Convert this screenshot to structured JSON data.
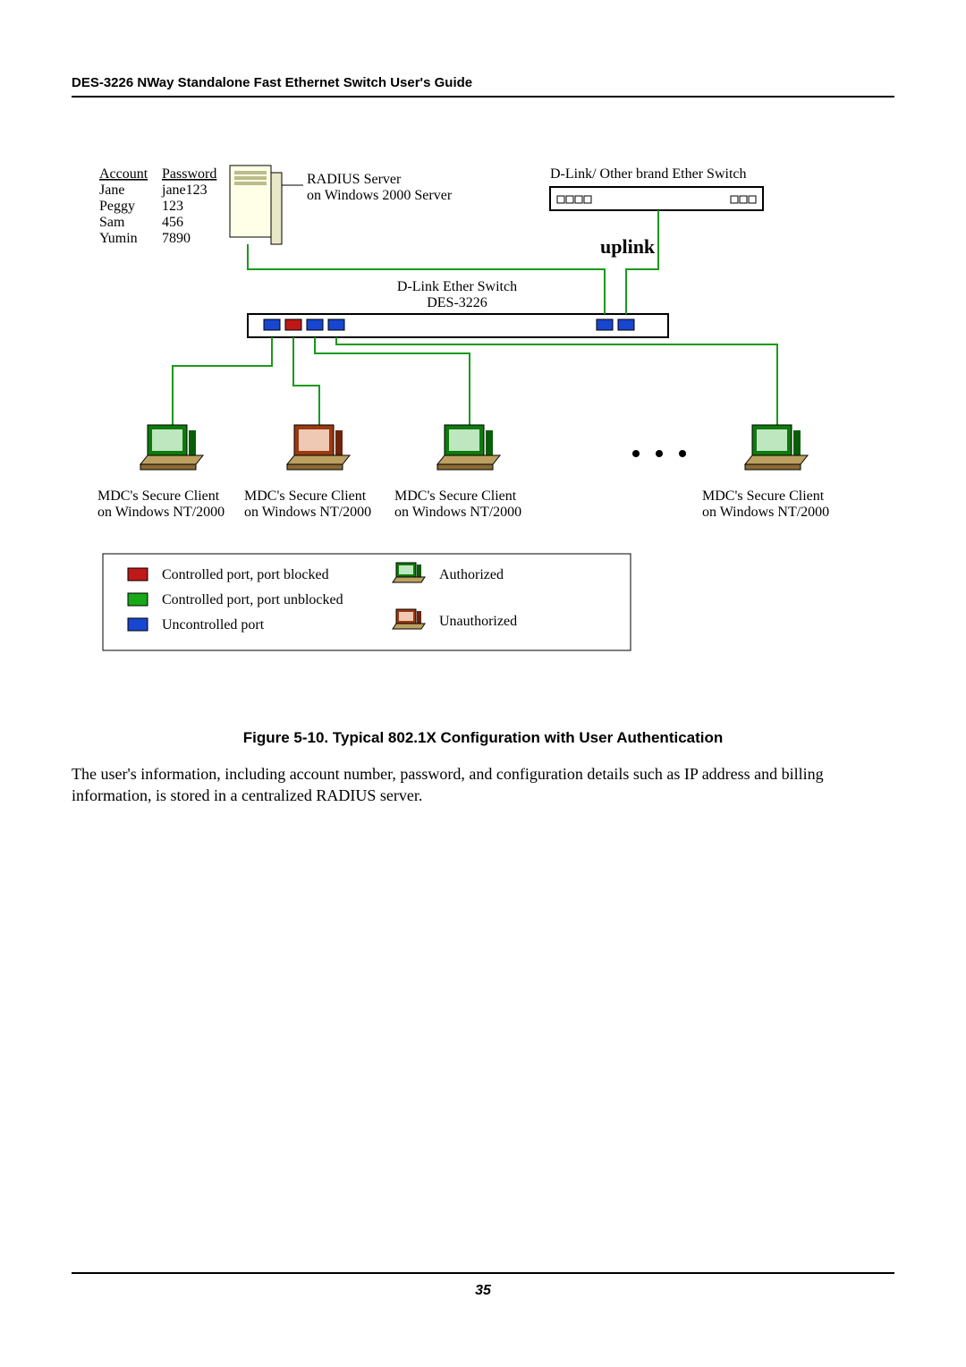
{
  "header": {
    "title": "DES-3226 NWay Standalone Fast Ethernet Switch User's Guide"
  },
  "diagram": {
    "accountsHeader": {
      "col1": "Account",
      "col2": "Password"
    },
    "accounts": [
      {
        "name": "Jane",
        "pwd": "jane123"
      },
      {
        "name": "Peggy",
        "pwd": "123"
      },
      {
        "name": "Sam",
        "pwd": "456"
      },
      {
        "name": "Yumin",
        "pwd": "7890"
      }
    ],
    "radius": {
      "l1": "RADIUS Server",
      "l2": "on Windows 2000 Server"
    },
    "otherSwitch": "D-Link/ Other brand Ether Switch",
    "uplink": "uplink",
    "centerSwitch": {
      "l1": "D-Link Ether Switch",
      "l2": "DES-3226"
    },
    "client": {
      "l1": "MDC's Secure Client",
      "l2": "on Windows NT/2000"
    },
    "legend": {
      "blocked": "Controlled port, port blocked",
      "unblocked": "Controlled port, port unblocked",
      "uncontrolled": "Uncontrolled port",
      "authorized": "Authorized",
      "unauthorized": "Unauthorized"
    }
  },
  "caption": "Figure 5-10.  Typical 802.1X Configuration with User Authentication",
  "body": "The user's information, including account number, password, and configuration details such as IP address and billing information, is stored in a centralized RADIUS server.",
  "pageNumber": "35"
}
